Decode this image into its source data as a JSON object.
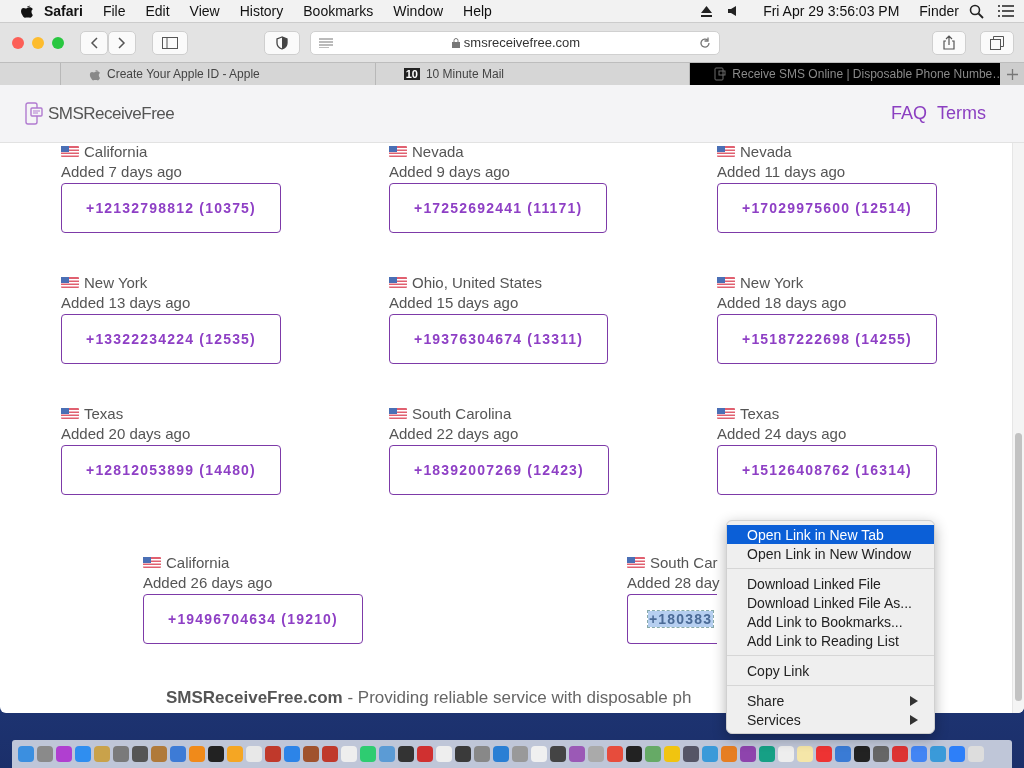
{
  "menu_bar": {
    "app": "Safari",
    "menus": [
      "File",
      "Edit",
      "View",
      "History",
      "Bookmarks",
      "Window",
      "Help"
    ],
    "clock": "Fri Apr 29  3:56:03 PM",
    "finder": "Finder"
  },
  "toolbar": {
    "address": "smsreceivefree.com"
  },
  "tabs": [
    {
      "title": "Create Your Apple ID - Apple",
      "selected": false,
      "kind": "apple"
    },
    {
      "title": "10 Minute Mail",
      "selected": false,
      "kind": "badge",
      "badge": "10"
    },
    {
      "title": "Receive SMS Online | Disposable Phone Numbe…",
      "selected": true,
      "kind": "phone"
    }
  ],
  "site": {
    "logo": "SMSReceiveFree",
    "nav": [
      "FAQ",
      "Terms"
    ]
  },
  "rows": [
    [
      {
        "location": "California",
        "added": "Added 7 days ago",
        "number": "+12132798812 (10375)"
      },
      {
        "location": "Nevada",
        "added": "Added 9 days ago",
        "number": "+17252692441 (11171)"
      },
      {
        "location": "Nevada",
        "added": "Added 11 days ago",
        "number": "+17029975600 (12514)"
      }
    ],
    [
      {
        "location": "New York",
        "added": "Added 13 days ago",
        "number": "+13322234224 (12535)"
      },
      {
        "location": "Ohio, United States",
        "added": "Added 15 days ago",
        "number": "+19376304674 (13311)"
      },
      {
        "location": "New York",
        "added": "Added 18 days ago",
        "number": "+15187222698 (14255)"
      }
    ],
    [
      {
        "location": "Texas",
        "added": "Added 20 days ago",
        "number": "+12812053899 (14480)"
      },
      {
        "location": "South Carolina",
        "added": "Added 22 days ago",
        "number": "+18392007269 (12423)"
      },
      {
        "location": "Texas",
        "added": "Added 24 days ago",
        "number": "+15126408762 (16314)"
      }
    ]
  ],
  "last_row": [
    {
      "location": "California",
      "added": "Added 26 days ago",
      "number": "+19496704634 (19210)",
      "selected": false,
      "kind": "full"
    },
    {
      "location": "South Car",
      "added": "Added 28 day",
      "number": "+180383",
      "selected": true,
      "kind": "partial"
    }
  ],
  "footer": "**SMSReceiveFree.com** - Providing reliable service with disposable ph",
  "context_menu": {
    "groups": [
      [
        {
          "label": "Open Link in New Tab",
          "selected": true,
          "submenu": false
        },
        {
          "label": "Open Link in New Window",
          "selected": false,
          "submenu": false
        }
      ],
      [
        {
          "label": "Download Linked File",
          "selected": false,
          "submenu": false
        },
        {
          "label": "Download Linked File As...",
          "selected": false,
          "submenu": false
        },
        {
          "label": "Add Link to Bookmarks...",
          "selected": false,
          "submenu": false
        },
        {
          "label": "Add Link to Reading List",
          "selected": false,
          "submenu": false
        }
      ],
      [
        {
          "label": "Copy Link",
          "selected": false,
          "submenu": false
        }
      ],
      [
        {
          "label": "Share",
          "selected": false,
          "submenu": true
        },
        {
          "label": "Services",
          "selected": false,
          "submenu": true
        }
      ]
    ]
  }
}
